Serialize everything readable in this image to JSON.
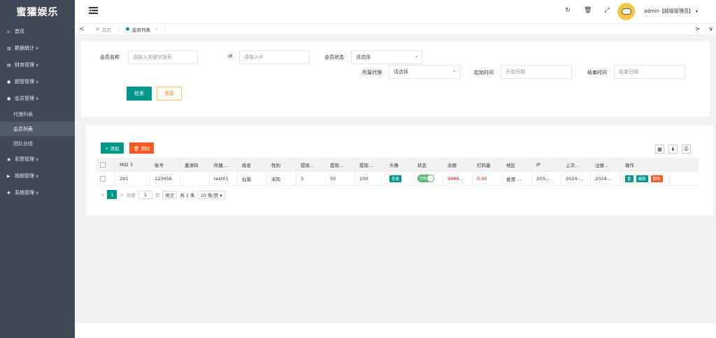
{
  "app": {
    "logo": "蜜獾娱乐"
  },
  "sidebar": {
    "items": [
      {
        "label": "首页",
        "icon": "home-icon",
        "glyph": "⌂"
      },
      {
        "label": "数据统计",
        "icon": "chart-icon",
        "glyph": "▥",
        "chevron": "∨"
      },
      {
        "label": "财务管理",
        "icon": "bank-icon",
        "glyph": "▤",
        "chevron": "∨"
      },
      {
        "label": "超管管理",
        "icon": "user-icon",
        "glyph": "●",
        "chevron": "∨"
      },
      {
        "label": "会员管理",
        "icon": "users-icon",
        "glyph": "●",
        "chevron": "∧"
      }
    ],
    "subitems": [
      {
        "label": "代理列表"
      },
      {
        "label": "会员列表"
      },
      {
        "label": "团队业绩"
      }
    ],
    "items2": [
      {
        "label": "彩票管理",
        "icon": "lottery-icon",
        "glyph": "◉",
        "chevron": "∨"
      },
      {
        "label": "视频管理",
        "icon": "video-icon",
        "glyph": "▶",
        "chevron": "∨"
      },
      {
        "label": "系统管理",
        "icon": "gear-icon",
        "glyph": "✱",
        "chevron": "∨"
      }
    ]
  },
  "topbar": {
    "menu_icon": "menu-toggle-icon",
    "icons": [
      "refresh-icon",
      "trash-icon",
      "fullscreen-icon"
    ],
    "icon_glyphs": [
      "↻",
      "🗑",
      "⤢"
    ],
    "user": "admin【超级管理员】",
    "caret": "▾"
  },
  "tabs": {
    "left_arrow": "<",
    "right_arrow": ">",
    "down_arrow": "∨",
    "items": [
      {
        "label": "首页"
      },
      {
        "label": "会员列表",
        "close": "×"
      }
    ]
  },
  "search": {
    "member_name_label": "会员名称",
    "member_name_placeholder": "请输入关键字搜索",
    "ip_label": "IP",
    "ip_placeholder": "请输入IP",
    "status_label": "会员状态",
    "status_value": "请选择",
    "agent_label": "所属代理",
    "agent_value": "请选择",
    "start_label": "起始时间",
    "start_placeholder": "开始日期",
    "end_label": "结束时间",
    "end_placeholder": "结束日期",
    "search_btn": "检索",
    "reset_btn": "重置"
  },
  "toolbar": {
    "add_btn": "+ 添加",
    "delete_btn": "🗑 删除",
    "icons": [
      "columns-icon",
      "export-icon",
      "print-icon"
    ],
    "icon_glyphs": [
      "▦",
      "⬇",
      "⎙"
    ]
  },
  "table": {
    "headers": [
      "MID ⇕",
      "账号",
      "邀请码",
      "所属...",
      "姓名",
      "性别",
      "提现...",
      "提现...",
      "提现...",
      "头像",
      "状态",
      "余额",
      "打码量",
      "地区",
      "IP",
      "上次...",
      "注册...",
      "操作"
    ],
    "rows": [
      {
        "mid": "291",
        "account": "123456",
        "invite": "",
        "agent": "test01",
        "name": "仙猫",
        "gender": "未知",
        "w1": "3",
        "w2": "50",
        "w3": "100",
        "avatar_btn": "查看",
        "status": "开启",
        "balance": "9989...",
        "bet": "0.00",
        "region": "香港 ...",
        "ip": "203....",
        "last": "2024-...",
        "reg": "2024-...",
        "op1": "置",
        "op2": "编辑",
        "op3": "删除"
      }
    ]
  },
  "pager": {
    "prev": "<",
    "page": "1",
    "next": ">",
    "goto_label": "到第",
    "goto_value": "1",
    "page_unit": "页",
    "confirm": "确定",
    "total": "共 1 条",
    "size": "10 条/页 ▾"
  },
  "colors": {
    "accent": "#009688",
    "danger": "#ff5722",
    "sidebar": "#3f4a56"
  }
}
